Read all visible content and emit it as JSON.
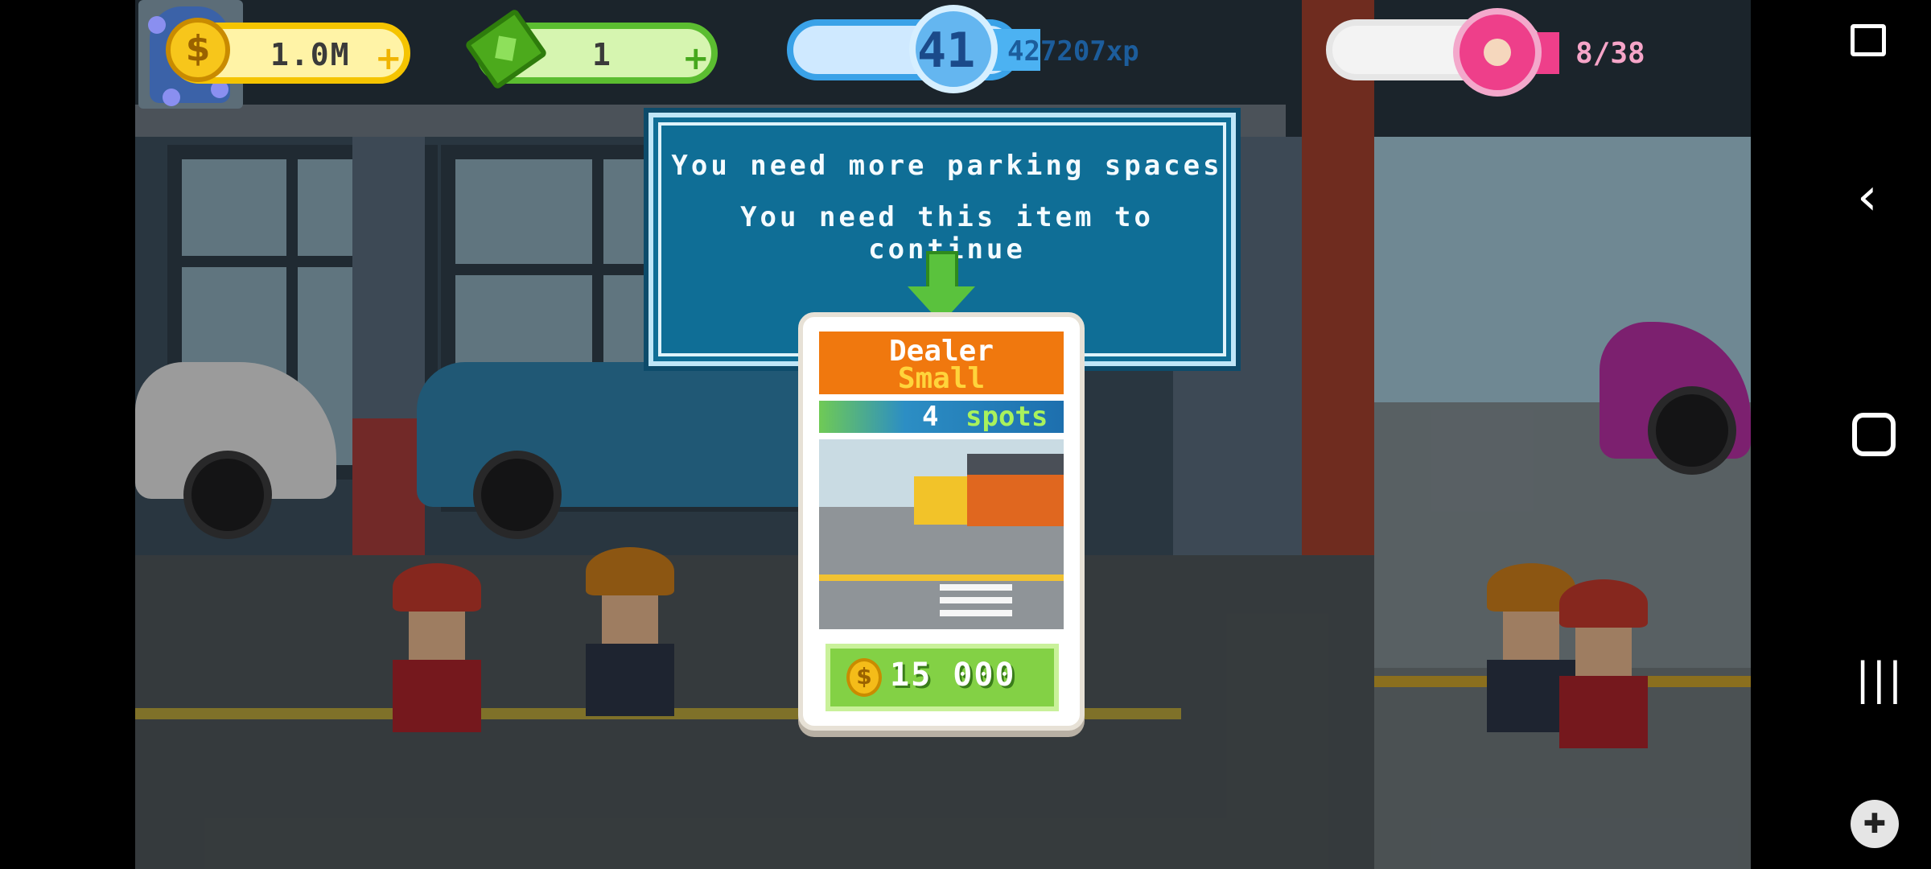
{
  "hud": {
    "coins": "1.0M",
    "coin_plus": "+",
    "cash": "1",
    "cash_plus": "+",
    "level": "41",
    "xp": "427207xp",
    "xp_progress": 0.45,
    "donuts": "8/38",
    "donut_progress": 0.21
  },
  "popup": {
    "line1": "You need more parking spaces",
    "line2": "You need this item to continue"
  },
  "card": {
    "title": "Dealer",
    "subtitle": "Small",
    "spots_count": "4",
    "spots_label": "spots",
    "price": "15 000"
  },
  "icons": {
    "coin": "coin-icon",
    "cash": "cash-icon",
    "xp": "level-badge",
    "donut": "donut-icon",
    "back": "back-icon",
    "home": "home-icon",
    "recents": "recents-icon",
    "gamepad": "gamepad-icon"
  },
  "colors": {
    "popup_bg": "#0f6e96",
    "card_header": "#f0780e",
    "buy_button": "#83d145",
    "coin": "#f7c61b",
    "donut": "#ee3f8a"
  }
}
